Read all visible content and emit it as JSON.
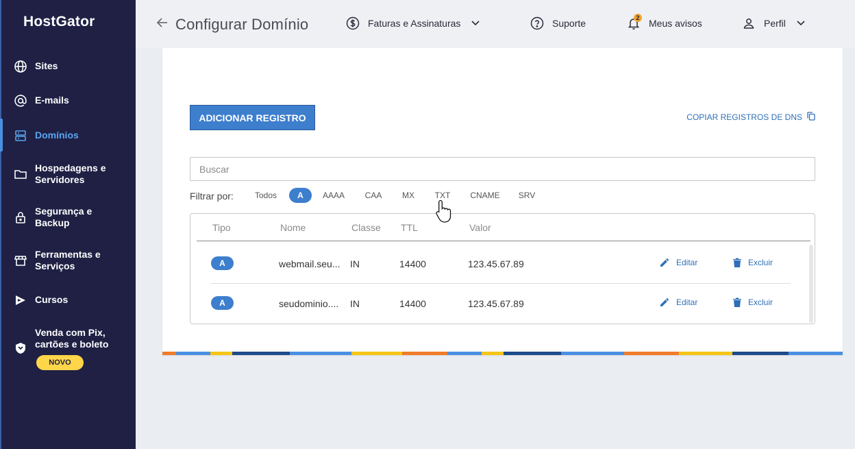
{
  "sidebar": {
    "logo": "HostGator",
    "items": [
      {
        "label": "Sites",
        "icon": "globe-icon"
      },
      {
        "label": "E-mails",
        "icon": "at-icon"
      },
      {
        "label": "Domínios",
        "icon": "server-icon",
        "active": true
      },
      {
        "label": "Hospedagens e Servidores",
        "icon": "folder-icon"
      },
      {
        "label": "Segurança e Backup",
        "icon": "lock-icon"
      },
      {
        "label": "Ferramentas e Serviços",
        "icon": "store-icon"
      },
      {
        "label": "Cursos",
        "icon": "play-icon"
      },
      {
        "label": "Venda com Pix, cartões e boleto",
        "icon": "shield-icon"
      }
    ],
    "badge": "NOVO"
  },
  "header": {
    "title": "Configurar Domínio",
    "billing": "Faturas e Assinaturas",
    "support": "Suporte",
    "notices": "Meus avisos",
    "notices_count": "2",
    "profile": "Perfil"
  },
  "main": {
    "add_button": "ADICIONAR REGISTRO",
    "copy_dns": "COPIAR REGISTROS DE DNS",
    "search_placeholder": "Buscar",
    "filter_label": "Filtrar por:",
    "filters": [
      "Todos",
      "A",
      "AAAA",
      "CAA",
      "MX",
      "TXT",
      "CNAME",
      "SRV"
    ],
    "active_filter": "A",
    "columns": [
      "Tipo",
      "Nome",
      "Classe",
      "TTL",
      "Valor"
    ],
    "rows": [
      {
        "type": "A",
        "name": "webmail.seu...",
        "class": "IN",
        "ttl": "14400",
        "value": "123.45.67.89"
      },
      {
        "type": "A",
        "name": "seudominio....",
        "class": "IN",
        "ttl": "14400",
        "value": "123.45.67.89"
      }
    ],
    "edit_label": "Editar",
    "delete_label": "Excluir"
  },
  "colors": {
    "sidebar_bg": "#1f2044",
    "accent": "#3d7ecd",
    "active_nav": "#5aa5f0",
    "badge": "#ffd54a",
    "stripe": [
      "#f07c2a",
      "#4a90e2",
      "#f5c518",
      "#1d4a8a"
    ]
  }
}
